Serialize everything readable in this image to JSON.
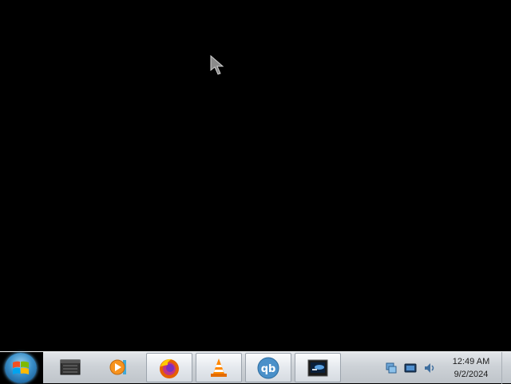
{
  "taskbar": {
    "start_button_icon": "windows-logo-icon",
    "apps": [
      {
        "name": "Archive Manager",
        "icon": "archive-icon",
        "state": "pinned"
      },
      {
        "name": "Media Player",
        "icon": "media-player-icon",
        "state": "pinned"
      },
      {
        "name": "Firefox",
        "icon": "firefox-icon",
        "state": "running"
      },
      {
        "name": "VLC Media Player",
        "icon": "vlc-icon",
        "state": "running"
      },
      {
        "name": "qBittorrent",
        "icon": "qbittorrent-icon",
        "state": "running"
      },
      {
        "name": "Terminal",
        "icon": "terminal-icon",
        "state": "running"
      }
    ],
    "tray_icons": [
      "network-icon",
      "display-icon",
      "volume-icon"
    ]
  },
  "clock": {
    "time": "12:49 AM",
    "date": "9/2/2024"
  },
  "colors": {
    "desktop_background": "#000000",
    "taskbar_background": "#cdd2d7"
  }
}
